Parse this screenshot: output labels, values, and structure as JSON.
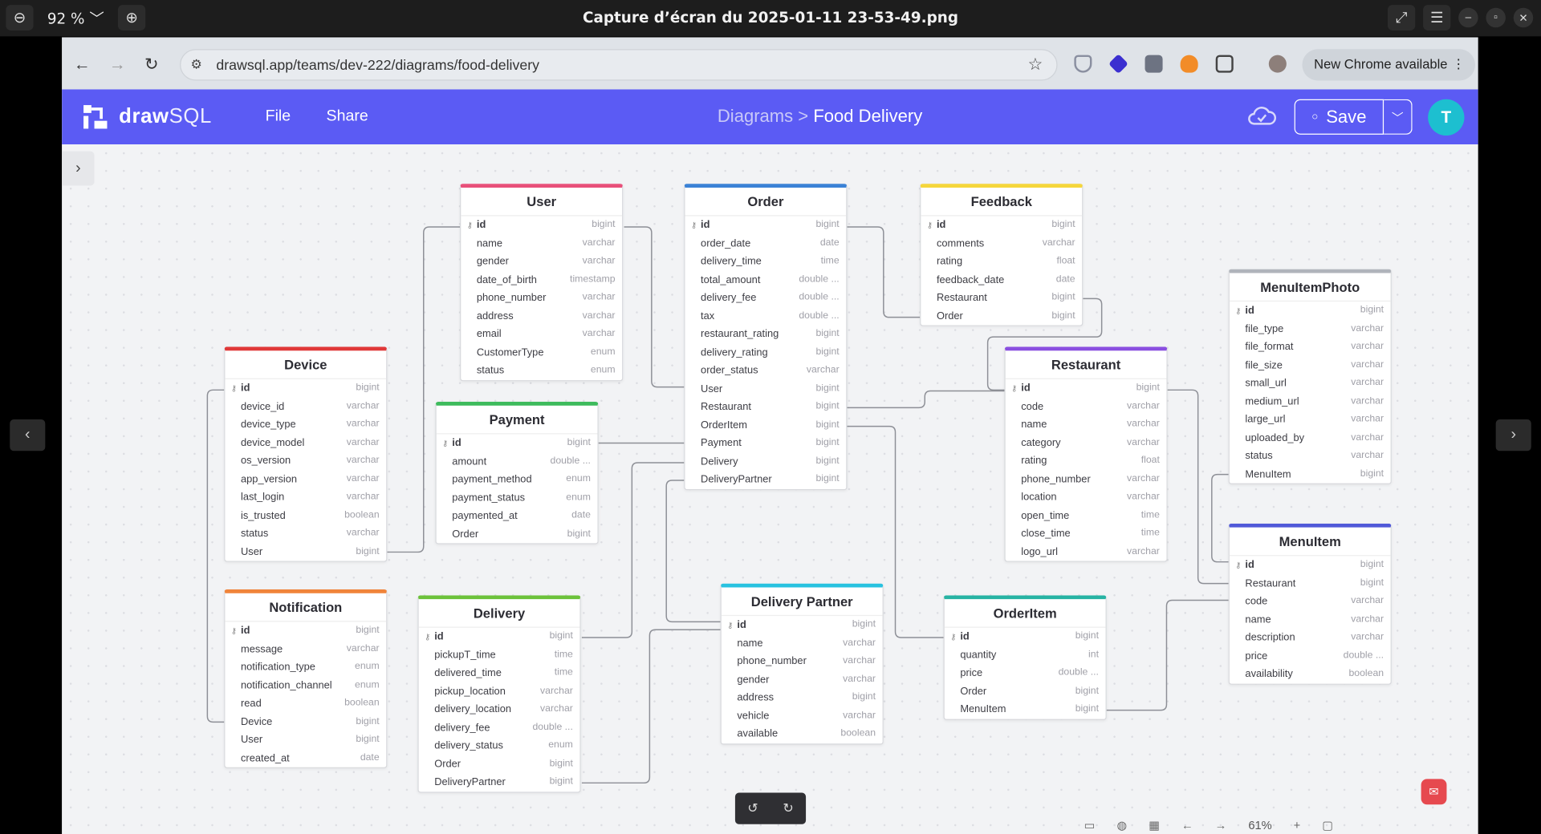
{
  "viewer": {
    "zoom": "92 %",
    "title": "Capture d’écran du 2025-01-11 23-53-49.png"
  },
  "browser": {
    "url": "drawsql.app/teams/dev-222/diagrams/food-delivery",
    "new_chrome": "New Chrome available"
  },
  "app": {
    "logo_a": "draw",
    "logo_b": "SQL",
    "menu": [
      "File",
      "Share"
    ],
    "breadcrumb_parent": "Diagrams >",
    "breadcrumb_current": "Food Delivery",
    "save_label": "Save",
    "avatar_initial": "T",
    "accent": "#5b5bf4"
  },
  "bottom": {
    "zoom_label": "61%"
  },
  "tables": [
    {
      "name": "User",
      "color": "#e8507a",
      "columns": [
        [
          "id",
          "bigint"
        ],
        [
          "name",
          "varchar"
        ],
        [
          "gender",
          "varchar"
        ],
        [
          "date_of_birth",
          "timestamp"
        ],
        [
          "phone_number",
          "varchar"
        ],
        [
          "address",
          "varchar"
        ],
        [
          "email",
          "varchar"
        ],
        [
          "CustomerType",
          "enum"
        ],
        [
          "status",
          "enum"
        ]
      ]
    },
    {
      "name": "Order",
      "color": "#3b82d6",
      "columns": [
        [
          "id",
          "bigint"
        ],
        [
          "order_date",
          "date"
        ],
        [
          "delivery_time",
          "time"
        ],
        [
          "total_amount",
          "double ..."
        ],
        [
          "delivery_fee",
          "double ..."
        ],
        [
          "tax",
          "double ..."
        ],
        [
          "restaurant_rating",
          "bigint"
        ],
        [
          "delivery_rating",
          "bigint"
        ],
        [
          "order_status",
          "varchar"
        ],
        [
          "User",
          "bigint"
        ],
        [
          "Restaurant",
          "bigint"
        ],
        [
          "OrderItem",
          "bigint"
        ],
        [
          "Payment",
          "bigint"
        ],
        [
          "Delivery",
          "bigint"
        ],
        [
          "DeliveryPartner",
          "bigint"
        ]
      ]
    },
    {
      "name": "Feedback",
      "color": "#f5d63b",
      "columns": [
        [
          "id",
          "bigint"
        ],
        [
          "comments",
          "varchar"
        ],
        [
          "rating",
          "float"
        ],
        [
          "feedback_date",
          "date"
        ],
        [
          "Restaurant",
          "bigint"
        ],
        [
          "Order",
          "bigint"
        ]
      ]
    },
    {
      "name": "MenuItemPhoto",
      "color": "#b0b4bb",
      "columns": [
        [
          "id",
          "bigint"
        ],
        [
          "file_type",
          "varchar"
        ],
        [
          "file_format",
          "varchar"
        ],
        [
          "file_size",
          "varchar"
        ],
        [
          "small_url",
          "varchar"
        ],
        [
          "medium_url",
          "varchar"
        ],
        [
          "large_url",
          "varchar"
        ],
        [
          "uploaded_by",
          "varchar"
        ],
        [
          "status",
          "varchar"
        ],
        [
          "MenuItem",
          "bigint"
        ]
      ]
    },
    {
      "name": "Device",
      "color": "#e03838",
      "columns": [
        [
          "id",
          "bigint"
        ],
        [
          "device_id",
          "varchar"
        ],
        [
          "device_type",
          "varchar"
        ],
        [
          "device_model",
          "varchar"
        ],
        [
          "os_version",
          "varchar"
        ],
        [
          "app_version",
          "varchar"
        ],
        [
          "last_login",
          "varchar"
        ],
        [
          "is_trusted",
          "boolean"
        ],
        [
          "status",
          "varchar"
        ],
        [
          "User",
          "bigint"
        ]
      ]
    },
    {
      "name": "Payment",
      "color": "#3dbb5c",
      "columns": [
        [
          "id",
          "bigint"
        ],
        [
          "amount",
          "double ..."
        ],
        [
          "payment_method",
          "enum"
        ],
        [
          "payment_status",
          "enum"
        ],
        [
          "paymented_at",
          "date"
        ],
        [
          "Order",
          "bigint"
        ]
      ]
    },
    {
      "name": "Restaurant",
      "color": "#8a4fe0",
      "columns": [
        [
          "id",
          "bigint"
        ],
        [
          "code",
          "varchar"
        ],
        [
          "name",
          "varchar"
        ],
        [
          "category",
          "varchar"
        ],
        [
          "rating",
          "float"
        ],
        [
          "phone_number",
          "varchar"
        ],
        [
          "location",
          "varchar"
        ],
        [
          "open_time",
          "time"
        ],
        [
          "close_time",
          "time"
        ],
        [
          "logo_url",
          "varchar"
        ]
      ]
    },
    {
      "name": "Notification",
      "color": "#f0843a",
      "columns": [
        [
          "id",
          "bigint"
        ],
        [
          "message",
          "varchar"
        ],
        [
          "notification_type",
          "enum"
        ],
        [
          "notification_channel",
          "enum"
        ],
        [
          "read",
          "boolean"
        ],
        [
          "Device",
          "bigint"
        ],
        [
          "User",
          "bigint"
        ],
        [
          "created_at",
          "date"
        ]
      ]
    },
    {
      "name": "Delivery",
      "color": "#6cc23a",
      "columns": [
        [
          "id",
          "bigint"
        ],
        [
          "pickupT_time",
          "time"
        ],
        [
          "delivered_time",
          "time"
        ],
        [
          "pickup_location",
          "varchar"
        ],
        [
          "delivery_location",
          "varchar"
        ],
        [
          "delivery_fee",
          "double ..."
        ],
        [
          "delivery_status",
          "enum"
        ],
        [
          "Order",
          "bigint"
        ],
        [
          "DeliveryPartner",
          "bigint"
        ]
      ]
    },
    {
      "name": "Delivery Partner",
      "color": "#28c2e0",
      "columns": [
        [
          "id",
          "bigint"
        ],
        [
          "name",
          "varchar"
        ],
        [
          "phone_number",
          "varchar"
        ],
        [
          "gender",
          "varchar"
        ],
        [
          "address",
          "bigint"
        ],
        [
          "vehicle",
          "varchar"
        ],
        [
          "available",
          "boolean"
        ]
      ]
    },
    {
      "name": "OrderItem",
      "color": "#27b3a3",
      "columns": [
        [
          "id",
          "bigint"
        ],
        [
          "quantity",
          "int"
        ],
        [
          "price",
          "double ..."
        ],
        [
          "Order",
          "bigint"
        ],
        [
          "MenuItem",
          "bigint"
        ]
      ]
    },
    {
      "name": "MenuItem",
      "color": "#5159d8",
      "columns": [
        [
          "id",
          "bigint"
        ],
        [
          "Restaurant",
          "bigint"
        ],
        [
          "code",
          "varchar"
        ],
        [
          "name",
          "varchar"
        ],
        [
          "description",
          "varchar"
        ],
        [
          "price",
          "double ..."
        ],
        [
          "availability",
          "boolean"
        ]
      ]
    }
  ]
}
